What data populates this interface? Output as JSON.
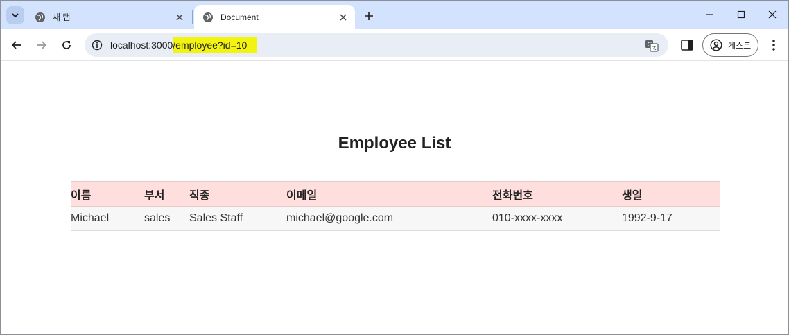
{
  "browser": {
    "tabs": [
      {
        "title": "새 탭",
        "active": false
      },
      {
        "title": "Document",
        "active": true
      }
    ],
    "url": {
      "host": "localhost:3000",
      "path": "/employee?id=10"
    },
    "profile_label": "게스트",
    "icons": {
      "tab_search": "chevron-down-icon",
      "favicon": "globe-icon",
      "close": "close-icon",
      "new_tab": "plus-icon",
      "back": "back-arrow-icon",
      "forward": "forward-arrow-icon",
      "reload": "reload-icon",
      "site_info": "info-icon",
      "translate": "translate-icon",
      "side_panel": "side-panel-icon",
      "profile": "avatar-icon",
      "menu": "kebab-menu-icon"
    },
    "colors": {
      "tabstrip": "#d3e3fd",
      "omnibox": "#e9eef6",
      "url_highlight": "#f3f312"
    }
  },
  "page": {
    "title": "Employee List",
    "table": {
      "columns": [
        "이름",
        "부서",
        "직종",
        "이메일",
        "전화번호",
        "생일"
      ],
      "rows": [
        [
          "Michael",
          "sales",
          "Sales Staff",
          "michael@google.com",
          "010-xxxx-xxxx",
          "1992-9-17"
        ]
      ]
    },
    "colors": {
      "header_bg": "#ffdede",
      "row_bg": "#f7f7f7"
    }
  }
}
